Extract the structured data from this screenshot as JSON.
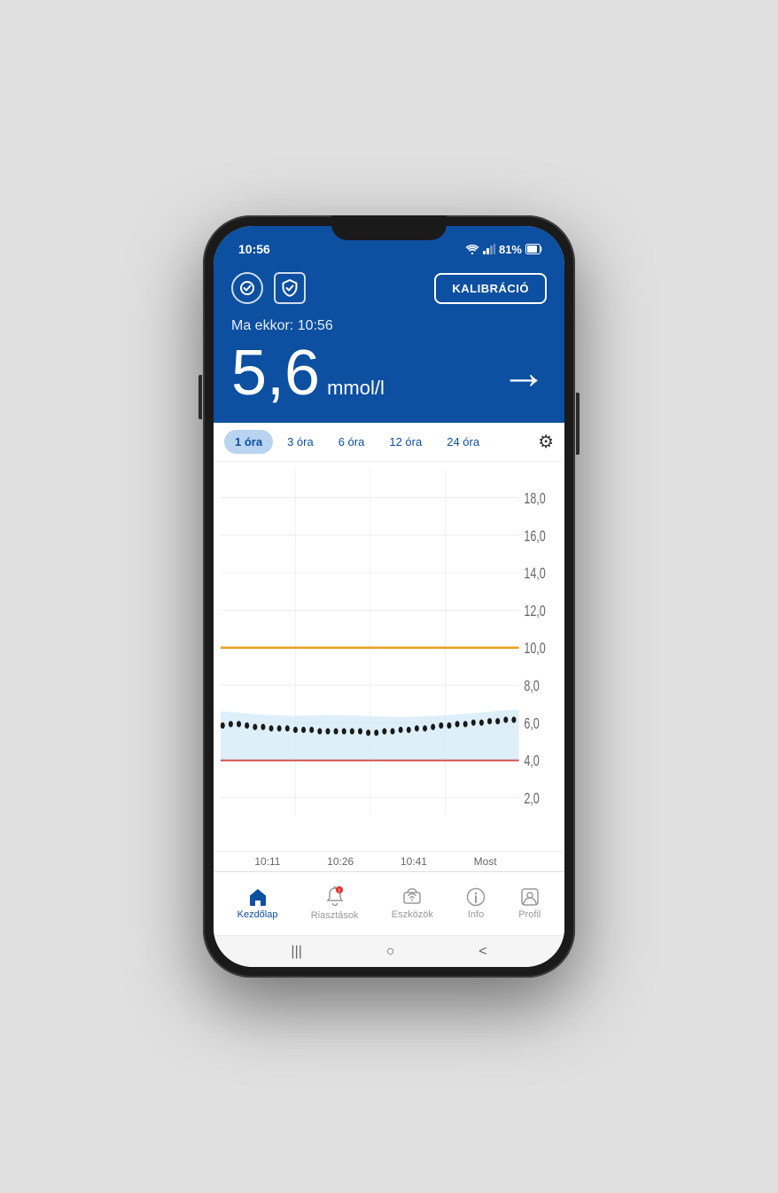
{
  "statusBar": {
    "time": "10:56",
    "battery": "81%",
    "wifi": "WiFi"
  },
  "header": {
    "calibrationLabel": "KALIBRÁCIÓ",
    "readingTimeLabel": "Ma ekkor: 10:56",
    "readingValue": "5,6",
    "readingUnit": "mmol/l"
  },
  "chartTabs": [
    {
      "label": "1 óra",
      "active": true
    },
    {
      "label": "3 óra",
      "active": false
    },
    {
      "label": "6 óra",
      "active": false
    },
    {
      "label": "12 óra",
      "active": false
    },
    {
      "label": "24 óra",
      "active": false
    }
  ],
  "chartYLabels": [
    "18,0",
    "16,0",
    "14,0",
    "12,0",
    "10,0",
    "8,0",
    "6,0",
    "4,0",
    "2,0"
  ],
  "chartTimeLabels": [
    "10:11",
    "10:26",
    "10:41",
    "Most"
  ],
  "colors": {
    "primary": "#0d4fa0",
    "upperLine": "#e8a020",
    "lowerLine": "#d0302a",
    "chartFill": "#d0e8f8",
    "dotColor": "#1a1a1a"
  },
  "bottomNav": [
    {
      "label": "Kezdőlap",
      "icon": "🏠",
      "active": true
    },
    {
      "label": "Riasztások",
      "icon": "🔔",
      "active": false
    },
    {
      "label": "Eszközök",
      "icon": "📡",
      "active": false
    },
    {
      "label": "Info",
      "icon": "ℹ️",
      "active": false
    },
    {
      "label": "Profil",
      "icon": "👤",
      "active": false
    }
  ],
  "homeIndicator": {
    "items": [
      "|||",
      "○",
      "<"
    ]
  }
}
